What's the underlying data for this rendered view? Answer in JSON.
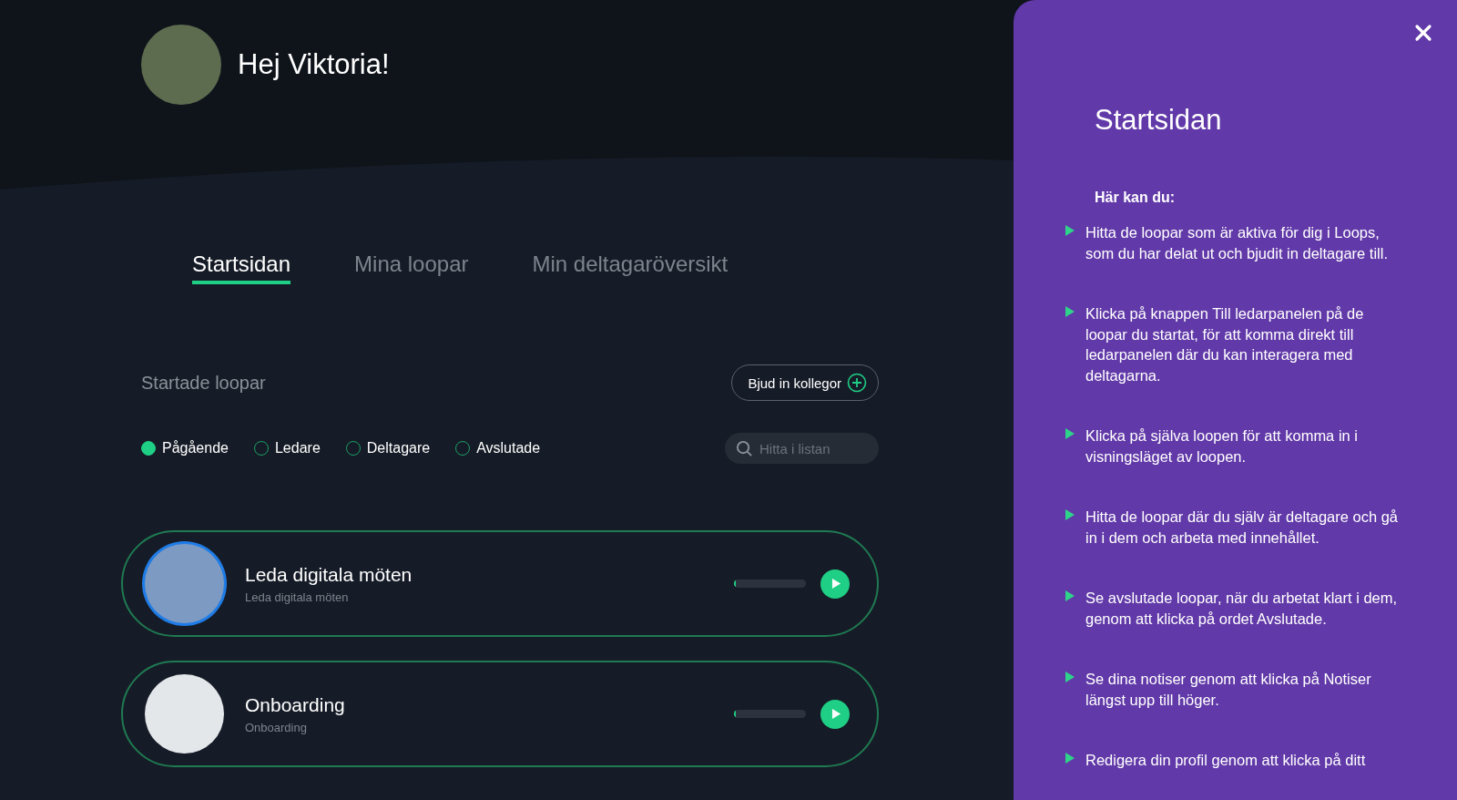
{
  "greeting": "Hej Viktoria!",
  "tabs": [
    {
      "label": "Startsidan",
      "selected": true
    },
    {
      "label": "Mina loopar",
      "selected": false
    },
    {
      "label": "Min deltagaröversikt",
      "selected": false
    }
  ],
  "section_title": "Startade loopar",
  "invite_button": "Bjud in kollegor",
  "filters": [
    {
      "label": "Pågående",
      "selected": true
    },
    {
      "label": "Ledare",
      "selected": false
    },
    {
      "label": "Deltagare",
      "selected": false
    },
    {
      "label": "Avslutade",
      "selected": false
    }
  ],
  "search": {
    "placeholder": "Hitta i listan"
  },
  "loops": [
    {
      "title": "Leda digitala möten",
      "subtitle": "Leda digitala möten",
      "level": 0.03
    },
    {
      "title": "Onboarding",
      "subtitle": "Onboarding",
      "level": 0.03
    }
  ],
  "help_panel": {
    "title": "Startsidan",
    "intro": "Här kan du:",
    "items": [
      "Hitta de loopar som är aktiva för dig i Loops, som du har delat ut och bjudit in deltagare till.",
      "Klicka på knappen Till ledarpanelen på de loopar du startat, för att komma direkt till ledarpanelen där du kan interagera med deltagarna.",
      "Klicka på själva loopen för att komma in i visningsläget av loopen.",
      "Hitta de loopar där du själv är deltagare och gå in i dem och arbeta med innehållet.",
      "Se avslutade loopar, när du arbetat klart i dem, genom att klicka på ordet Avslutade.",
      "Se dina notiser genom att klicka på Notiser längst upp till höger.",
      "Redigera din profil genom att klicka på ditt"
    ]
  }
}
